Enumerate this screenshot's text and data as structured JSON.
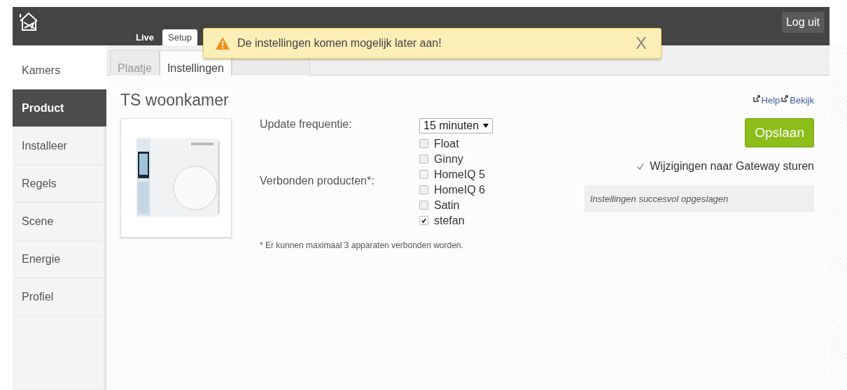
{
  "header": {
    "tabs": [
      {
        "label": "Live",
        "selected": false
      },
      {
        "label": "Setup",
        "selected": true
      }
    ],
    "logout": "Log uit"
  },
  "notification": {
    "message": "De instellingen komen mogelijk later aan!",
    "close": "X"
  },
  "sidebar": {
    "items": [
      {
        "label": "Kamers",
        "selected": false
      },
      {
        "label": "Product",
        "selected": true
      },
      {
        "label": "Installeer",
        "selected": false
      },
      {
        "label": "Regels",
        "selected": false
      },
      {
        "label": "Scene",
        "selected": false
      },
      {
        "label": "Energie",
        "selected": false
      },
      {
        "label": "Profiel",
        "selected": false
      }
    ]
  },
  "subtabs": [
    {
      "label": "Plaatje",
      "selected": false
    },
    {
      "label": "Instellingen",
      "selected": true
    },
    {
      "selected": false
    }
  ],
  "product": {
    "title": "TS woonkamer",
    "image": {
      "kind": "picture"
    },
    "links": [
      "Help",
      "Bekijk"
    ],
    "update_label": "Update frequentie:",
    "update_value": "15 minuten",
    "connected_label": "Verbonden producten*:",
    "connected": [
      {
        "name": "Float",
        "checked": false
      },
      {
        "name": "Ginny",
        "checked": false
      },
      {
        "name": "HomeIQ 5",
        "checked": false
      },
      {
        "name": "HomeIQ 6",
        "checked": false
      },
      {
        "name": "Satin",
        "checked": false
      },
      {
        "name": "stefan",
        "checked": true
      }
    ],
    "footnote": "* Er kunnen maximaal 3 apparaten verbonden worden.",
    "save": "Opslaan",
    "send_to_gateway": {
      "label": "Wijzigingen naar Gateway sturen",
      "checked": true
    },
    "status": "Instellingen succesvol opgeslagen"
  }
}
